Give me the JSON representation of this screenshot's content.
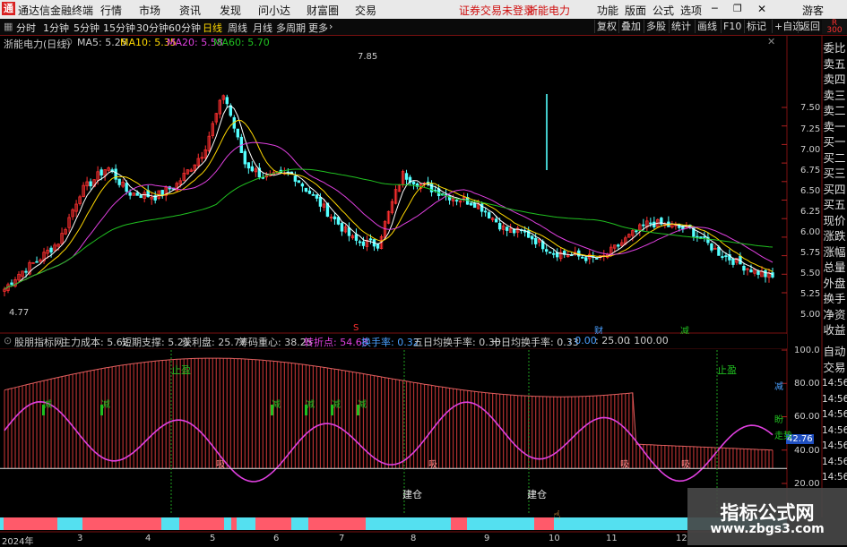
{
  "window": {
    "app_title": "通达信金融终端",
    "menu": [
      "行情",
      "市场",
      "资讯",
      "发现",
      "问小达",
      "财富圈",
      "交易"
    ],
    "status_notice": "证券交易未登录",
    "stock_tab": "浙能电力",
    "right_menu": [
      "功能",
      "版面",
      "公式",
      "选项"
    ],
    "user": "游客"
  },
  "toolbar": {
    "periods": [
      "分时",
      "1分钟",
      "5分钟",
      "15分钟",
      "30分钟",
      "60分钟",
      "日线",
      "周线",
      "月线",
      "多周期",
      "更多"
    ],
    "active_period": "日线",
    "right_buttons": [
      "复权",
      "叠加",
      "多股",
      "统计",
      "画线",
      "F10",
      "标记",
      "+自选",
      "返回"
    ],
    "more_chevron": "›"
  },
  "price_panel": {
    "stock_label": "浙能电力(日线)",
    "ma": [
      {
        "label": "MA5: 5.25",
        "color": "#ffffff"
      },
      {
        "label": "MA10: 5.35",
        "color": "#ffd800"
      },
      {
        "label": "MA20: 5.58",
        "color": "#e040e0"
      },
      {
        "label": "MA60: 5.70",
        "color": "#20c020"
      }
    ],
    "high_label": "7.85",
    "low_label": "4.77",
    "y_ticks": [
      "7.50",
      "7.25",
      "7.00",
      "6.75",
      "6.50",
      "6.25",
      "6.00",
      "5.75",
      "5.50",
      "5.25",
      "5.00"
    ],
    "markers": [
      {
        "text": "S",
        "color": "#ff3030"
      },
      {
        "text": "财",
        "color": "#4aa0ff"
      },
      {
        "text": "减",
        "color": "#20c020"
      }
    ]
  },
  "indicator_panel": {
    "name": "股朋指标网",
    "items": [
      {
        "label": "主力成本: 5.62",
        "color": "#ffffff"
      },
      {
        "label": "短期支撑: 5.21",
        "color": "#ffffff"
      },
      {
        "label": "获利盘: 25.77",
        "color": "#ffffff"
      },
      {
        "label": "筹码重心: 38.25",
        "color": "#ffffff"
      },
      {
        "label": "转折点: 54.68",
        "color": "#e040e0"
      },
      {
        "label": "换手率: 0.32",
        "color": "#4aa0ff"
      },
      {
        "label": "五日均换手率: 0.30",
        "color": "#ffffff"
      },
      {
        "label": "十日均换手率: 0.33",
        "color": "#ffffff"
      },
      {
        "label": ": 0.00",
        "color": "#4aa0ff"
      },
      {
        "label": ": 25.00",
        "color": "#ffffff"
      },
      {
        "label": ": 100.00",
        "color": "#ffffff"
      }
    ],
    "y_ticks": [
      "100.0",
      "80.00",
      "60.00",
      "40.00",
      "20.00"
    ],
    "current_value": "42.76",
    "annotations": {
      "stop_profit": "止盈",
      "reduce": "减",
      "absorb": "吸",
      "build": "建仓",
      "right_edge_1": "减",
      "right_edge_2": "盼",
      "right_edge_3": "走势"
    }
  },
  "sidebar": {
    "top_label": "R",
    "top_sub": "300",
    "items": [
      "委比",
      "卖五",
      "卖四",
      "卖三",
      "卖二",
      "卖一",
      "买一",
      "买二",
      "买三",
      "买四",
      "买五",
      "现价",
      "涨跌",
      "涨幅",
      "总量",
      "外盘",
      "换手",
      "净资",
      "收益"
    ],
    "lower_items": [
      "自动",
      "交易"
    ],
    "times": [
      "14:56",
      "14:56",
      "14:56",
      "14:56",
      "14:56",
      "14:56",
      "14:56"
    ]
  },
  "x_axis": {
    "labels": [
      "2024年",
      "3",
      "4",
      "5",
      "6",
      "7",
      "8",
      "9",
      "10",
      "11",
      "12"
    ]
  },
  "banner": {
    "title": "指标公式网",
    "url": "www.zbgs3.com"
  }
}
